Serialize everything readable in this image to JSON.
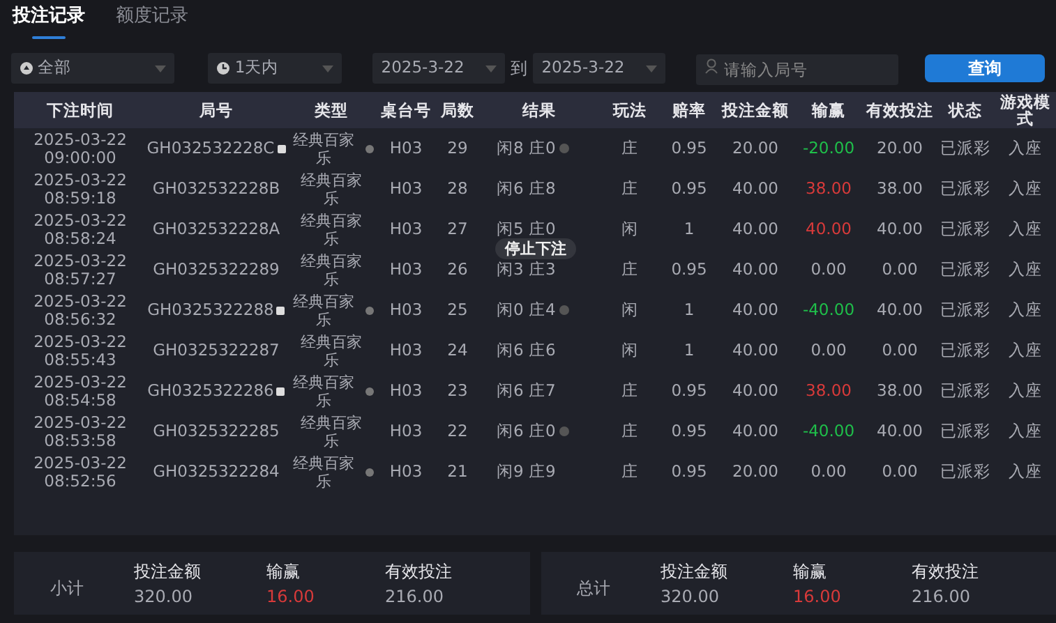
{
  "tabs": [
    {
      "label": "投注记录",
      "selected": true
    },
    {
      "label": "额度记录",
      "selected": false
    }
  ],
  "filters": {
    "scope": {
      "value": "全部"
    },
    "period": {
      "value": "1天内"
    },
    "date_from": {
      "value": "2025-3-22"
    },
    "date_separator": "到",
    "date_to": {
      "value": "2025-3-22"
    },
    "search": {
      "placeholder": "请输入局号"
    },
    "query_button": "查询"
  },
  "table": {
    "columns": [
      "下注时间",
      "局号",
      "类型",
      "桌台号",
      "局数",
      "结果",
      "玩法",
      "赔率",
      "投注金额",
      "输赢",
      "有效投注",
      "状态",
      "游戏模式"
    ],
    "rows": [
      {
        "date": "2025-03-22",
        "time": "09:00:00",
        "round_id": "GH032532228C",
        "id_marker": true,
        "type": "经典百家乐",
        "type_dot": true,
        "table": "H03",
        "round": "29",
        "result": "闲8 庄0",
        "result_info": true,
        "play": "庄",
        "odds": "0.95",
        "bet": "20.00",
        "win_loss": "-20.00",
        "color": "#1fbf4a",
        "valid_bet": "20.00",
        "status": "已派彩",
        "mode": "入座"
      },
      {
        "date": "2025-03-22",
        "time": "08:59:18",
        "round_id": "GH032532228B",
        "id_marker": false,
        "type": "经典百家乐",
        "type_dot": false,
        "table": "H03",
        "round": "28",
        "result": "闲6 庄8",
        "result_info": false,
        "play": "庄",
        "odds": "0.95",
        "bet": "40.00",
        "win_loss": "38.00",
        "color": "#d83a3a",
        "valid_bet": "38.00",
        "status": "已派彩",
        "mode": "入座"
      },
      {
        "date": "2025-03-22",
        "time": "08:58:24",
        "round_id": "GH032532228A",
        "id_marker": false,
        "type": "经典百家乐",
        "type_dot": false,
        "table": "H03",
        "round": "27",
        "result": "闲5 庄0",
        "result_info": false,
        "play": "闲",
        "odds": "1",
        "bet": "40.00",
        "win_loss": "40.00",
        "color": "#d83a3a",
        "valid_bet": "40.00",
        "status": "已派彩",
        "mode": "入座"
      },
      {
        "date": "2025-03-22",
        "time": "08:57:27",
        "round_id": "GH0325322289",
        "id_marker": false,
        "type": "经典百家乐",
        "type_dot": false,
        "table": "H03",
        "round": "26",
        "result": "闲3 庄3",
        "result_info": false,
        "play": "庄",
        "odds": "0.95",
        "bet": "40.00",
        "win_loss": "0.00",
        "color": "#a9abb3",
        "valid_bet": "0.00",
        "status": "已派彩",
        "mode": "入座"
      },
      {
        "date": "2025-03-22",
        "time": "08:56:32",
        "round_id": "GH0325322288",
        "id_marker": true,
        "type": "经典百家乐",
        "type_dot": true,
        "table": "H03",
        "round": "25",
        "result": "闲0 庄4",
        "result_info": true,
        "play": "闲",
        "odds": "1",
        "bet": "40.00",
        "win_loss": "-40.00",
        "color": "#1fbf4a",
        "valid_bet": "40.00",
        "status": "已派彩",
        "mode": "入座"
      },
      {
        "date": "2025-03-22",
        "time": "08:55:43",
        "round_id": "GH0325322287",
        "id_marker": false,
        "type": "经典百家乐",
        "type_dot": false,
        "table": "H03",
        "round": "24",
        "result": "闲6 庄6",
        "result_info": false,
        "play": "闲",
        "odds": "1",
        "bet": "40.00",
        "win_loss": "0.00",
        "color": "#a9abb3",
        "valid_bet": "0.00",
        "status": "已派彩",
        "mode": "入座"
      },
      {
        "date": "2025-03-22",
        "time": "08:54:58",
        "round_id": "GH0325322286",
        "id_marker": true,
        "type": "经典百家乐",
        "type_dot": true,
        "table": "H03",
        "round": "23",
        "result": "闲6 庄7",
        "result_info": false,
        "play": "庄",
        "odds": "0.95",
        "bet": "40.00",
        "win_loss": "38.00",
        "color": "#d83a3a",
        "valid_bet": "38.00",
        "status": "已派彩",
        "mode": "入座"
      },
      {
        "date": "2025-03-22",
        "time": "08:53:58",
        "round_id": "GH0325322285",
        "id_marker": false,
        "type": "经典百家乐",
        "type_dot": false,
        "table": "H03",
        "round": "22",
        "result": "闲6 庄0",
        "result_info": true,
        "play": "庄",
        "odds": "0.95",
        "bet": "40.00",
        "win_loss": "-40.00",
        "color": "#1fbf4a",
        "valid_bet": "40.00",
        "status": "已派彩",
        "mode": "入座"
      },
      {
        "date": "2025-03-22",
        "time": "08:52:56",
        "round_id": "GH0325322284",
        "id_marker": false,
        "type": "经典百家乐",
        "type_dot": true,
        "table": "H03",
        "round": "21",
        "result": "闲9 庄9",
        "result_info": false,
        "play": "庄",
        "odds": "0.95",
        "bet": "20.00",
        "win_loss": "0.00",
        "color": "#a9abb3",
        "valid_bet": "0.00",
        "status": "已派彩",
        "mode": "入座"
      }
    ]
  },
  "toast": "停止下注",
  "summaries": [
    {
      "label": "小计",
      "items": [
        {
          "label": "投注金额",
          "value": "320.00",
          "color": "#a9abb3"
        },
        {
          "label": "输赢",
          "value": "16.00",
          "color": "#d83a3a"
        },
        {
          "label": "有效投注",
          "value": "216.00",
          "color": "#a9abb3"
        }
      ]
    },
    {
      "label": "总计",
      "items": [
        {
          "label": "投注金额",
          "value": "320.00",
          "color": "#a9abb3"
        },
        {
          "label": "输赢",
          "value": "16.00",
          "color": "#d83a3a"
        },
        {
          "label": "有效投注",
          "value": "216.00",
          "color": "#a9abb3"
        }
      ]
    }
  ]
}
